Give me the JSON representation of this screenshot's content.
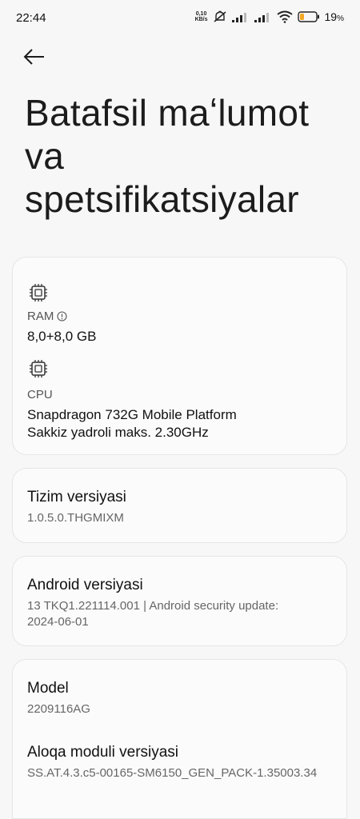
{
  "status_bar": {
    "time": "22:44",
    "net_speed_value": "0,10",
    "net_speed_unit": "KB/s",
    "battery_percent": "19",
    "battery_suffix": "%"
  },
  "header": {
    "title": "Batafsil maʻlumot va spetsifikatsiyalar"
  },
  "hardware_card": {
    "ram_label": "RAM",
    "ram_value": "8,0+8,0 GB",
    "cpu_label": "CPU",
    "cpu_value_line1": "Snapdragon 732G Mobile Platform",
    "cpu_value_line2": "Sakkiz yadroli maks. 2.30GHz"
  },
  "system_version_card": {
    "label": "Tizim versiyasi",
    "value": "1.0.5.0.THGMIXM"
  },
  "android_version_card": {
    "label": "Android versiyasi",
    "value_line1": "13 TKQ1.221114.001 | Android security update:",
    "value_line2": "2024-06-01"
  },
  "model_card": {
    "model_label": "Model",
    "model_value": "2209116AG",
    "baseband_label": "Aloqa moduli versiyasi",
    "baseband_value": "SS.AT.4.3.c5-00165-SM6150_GEN_PACK-1.35003.34"
  },
  "colors": {
    "background": "#f7f7f7",
    "card_background": "#fbfbfb",
    "battery_fill": "#f5a623"
  },
  "icons": [
    "back-arrow-icon",
    "chip-icon",
    "info-icon",
    "mute-icon",
    "signal-icon",
    "wifi-icon",
    "battery-icon"
  ]
}
